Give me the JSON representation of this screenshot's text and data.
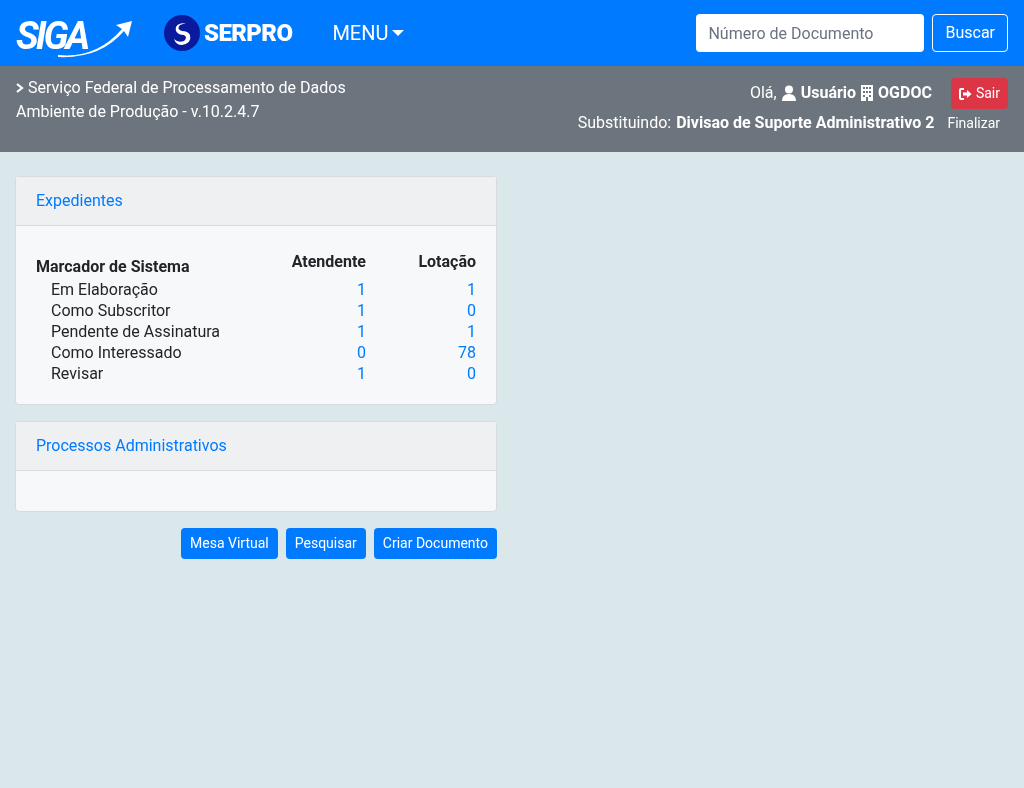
{
  "navbar": {
    "logo_text": "SIGA",
    "partner_logo_text": "SERPRO",
    "menu": "MENU",
    "search": {
      "placeholder": "Número de Documento"
    },
    "search_button": "Buscar"
  },
  "infobar": {
    "organization": "Serviço Federal de Processamento de Dados",
    "environment": "Ambiente de Produção - v.10.2.4.7",
    "greeting": "Olá,",
    "user": "Usuário",
    "unit": "OGDOC",
    "logout": "Sair",
    "substituting_label": "Substituindo:",
    "substituting": "Divisao de Suporte Administrativo 2",
    "finish": "Finalizar"
  },
  "cards": [
    {
      "title": "Expedientes",
      "table": {
        "columns": [
          "Marcador de Sistema",
          "Atendente",
          "Lotação"
        ],
        "rows": [
          {
            "label": "Em Elaboração",
            "atendente": "1",
            "lotacao": "1"
          },
          {
            "label": "Como Subscritor",
            "atendente": "1",
            "lotacao": "0"
          },
          {
            "label": "Pendente de Assinatura",
            "atendente": "1",
            "lotacao": "1"
          },
          {
            "label": "Como Interessado",
            "atendente": "0",
            "lotacao": "78"
          },
          {
            "label": "Revisar",
            "atendente": "1",
            "lotacao": "0"
          }
        ]
      }
    },
    {
      "title": "Processos Administrativos"
    }
  ],
  "buttons": [
    "Mesa Virtual",
    "Pesquisar",
    "Criar Documento"
  ]
}
